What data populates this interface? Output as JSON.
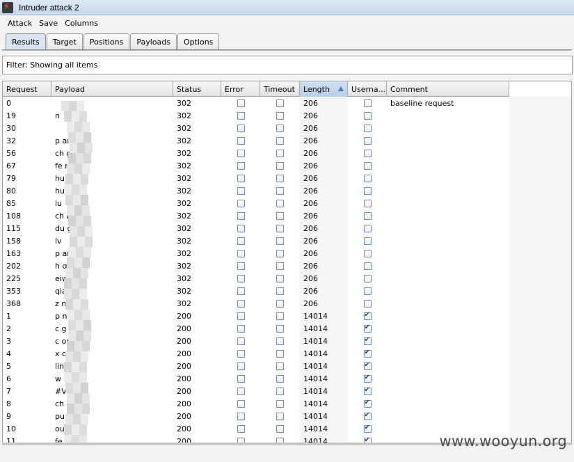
{
  "window": {
    "title": "Intruder attack 2"
  },
  "menu": [
    "Attack",
    "Save",
    "Columns"
  ],
  "tabs": [
    "Results",
    "Target",
    "Positions",
    "Payloads",
    "Options"
  ],
  "active_tab": "Results",
  "filter_text": "Filter:  Showing all items",
  "columns": [
    "Request",
    "Payload",
    "Status",
    "Error",
    "Timeout",
    "Length",
    "Userna...",
    "Comment"
  ],
  "sorted_column": "Length",
  "rows": [
    {
      "request": "0",
      "payload": "",
      "status": "302",
      "error": false,
      "timeout": false,
      "length": "206",
      "username": false,
      "comment": "baseline request"
    },
    {
      "request": "19",
      "payload": "n",
      "status": "302",
      "error": false,
      "timeout": false,
      "length": "206",
      "username": false,
      "comment": ""
    },
    {
      "request": "30",
      "payload": "",
      "status": "302",
      "error": false,
      "timeout": false,
      "length": "206",
      "username": false,
      "comment": ""
    },
    {
      "request": "32",
      "payload": "p        an",
      "status": "302",
      "error": false,
      "timeout": false,
      "length": "206",
      "username": false,
      "comment": ""
    },
    {
      "request": "56",
      "payload": "ch        gwei",
      "status": "302",
      "error": false,
      "timeout": false,
      "length": "206",
      "username": false,
      "comment": ""
    },
    {
      "request": "67",
      "payload": "fe        ming",
      "status": "302",
      "error": false,
      "timeout": false,
      "length": "206",
      "username": false,
      "comment": ""
    },
    {
      "request": "79",
      "payload": "hu        n",
      "status": "302",
      "error": false,
      "timeout": false,
      "length": "206",
      "username": false,
      "comment": ""
    },
    {
      "request": "80",
      "payload": "hu        .",
      "status": "302",
      "error": false,
      "timeout": false,
      "length": "206",
      "username": false,
      "comment": ""
    },
    {
      "request": "85",
      "payload": "lu",
      "status": "302",
      "error": false,
      "timeout": false,
      "length": "206",
      "username": false,
      "comment": ""
    },
    {
      "request": "108",
      "payload": "ch        bo",
      "status": "302",
      "error": false,
      "timeout": false,
      "length": "206",
      "username": false,
      "comment": ""
    },
    {
      "request": "115",
      "payload": "du        g",
      "status": "302",
      "error": false,
      "timeout": false,
      "length": "206",
      "username": false,
      "comment": ""
    },
    {
      "request": "158",
      "payload": "lv",
      "status": "302",
      "error": false,
      "timeout": false,
      "length": "206",
      "username": false,
      "comment": ""
    },
    {
      "request": "163",
      "payload": "p        an",
      "status": "302",
      "error": false,
      "timeout": false,
      "length": "206",
      "username": false,
      "comment": ""
    },
    {
      "request": "202",
      "payload": "h        qian",
      "status": "302",
      "error": false,
      "timeout": false,
      "length": "206",
      "username": false,
      "comment": ""
    },
    {
      "request": "225",
      "payload": "        eiwei",
      "status": "302",
      "error": false,
      "timeout": false,
      "length": "206",
      "username": false,
      "comment": ""
    },
    {
      "request": "353",
      "payload": "        qian",
      "status": "302",
      "error": false,
      "timeout": false,
      "length": "206",
      "username": false,
      "comment": ""
    },
    {
      "request": "368",
      "payload": "z        nin",
      "status": "302",
      "error": false,
      "timeout": false,
      "length": "206",
      "username": false,
      "comment": ""
    },
    {
      "request": "1",
      "payload": "p        ngli",
      "status": "200",
      "error": false,
      "timeout": false,
      "length": "14014",
      "username": true,
      "comment": ""
    },
    {
      "request": "2",
      "payload": "c        g",
      "status": "200",
      "error": false,
      "timeout": false,
      "length": "14014",
      "username": true,
      "comment": ""
    },
    {
      "request": "3",
      "payload": "c        ong",
      "status": "200",
      "error": false,
      "timeout": false,
      "length": "14014",
      "username": true,
      "comment": ""
    },
    {
      "request": "4",
      "payload": "x        ong",
      "status": "200",
      "error": false,
      "timeout": false,
      "length": "14014",
      "username": true,
      "comment": ""
    },
    {
      "request": "5",
      "payload": "lin",
      "status": "200",
      "error": false,
      "timeout": false,
      "length": "14014",
      "username": true,
      "comment": ""
    },
    {
      "request": "6",
      "payload": "w        ing",
      "status": "200",
      "error": false,
      "timeout": false,
      "length": "14014",
      "username": true,
      "comment": ""
    },
    {
      "request": "7",
      "payload": "#V        !",
      "status": "200",
      "error": false,
      "timeout": false,
      "length": "14014",
      "username": true,
      "comment": ""
    },
    {
      "request": "8",
      "payload": "ch        shi",
      "status": "200",
      "error": false,
      "timeout": false,
      "length": "14014",
      "username": true,
      "comment": ""
    },
    {
      "request": "9",
      "payload": "pu",
      "status": "200",
      "error": false,
      "timeout": false,
      "length": "14014",
      "username": true,
      "comment": ""
    },
    {
      "request": "10",
      "payload": "ouy        mei",
      "status": "200",
      "error": false,
      "timeout": false,
      "length": "14014",
      "username": true,
      "comment": ""
    },
    {
      "request": "11",
      "payload": "fe",
      "status": "200",
      "error": false,
      "timeout": false,
      "length": "14014",
      "username": true,
      "comment": ""
    }
  ],
  "watermark": "www.wooyun.org"
}
